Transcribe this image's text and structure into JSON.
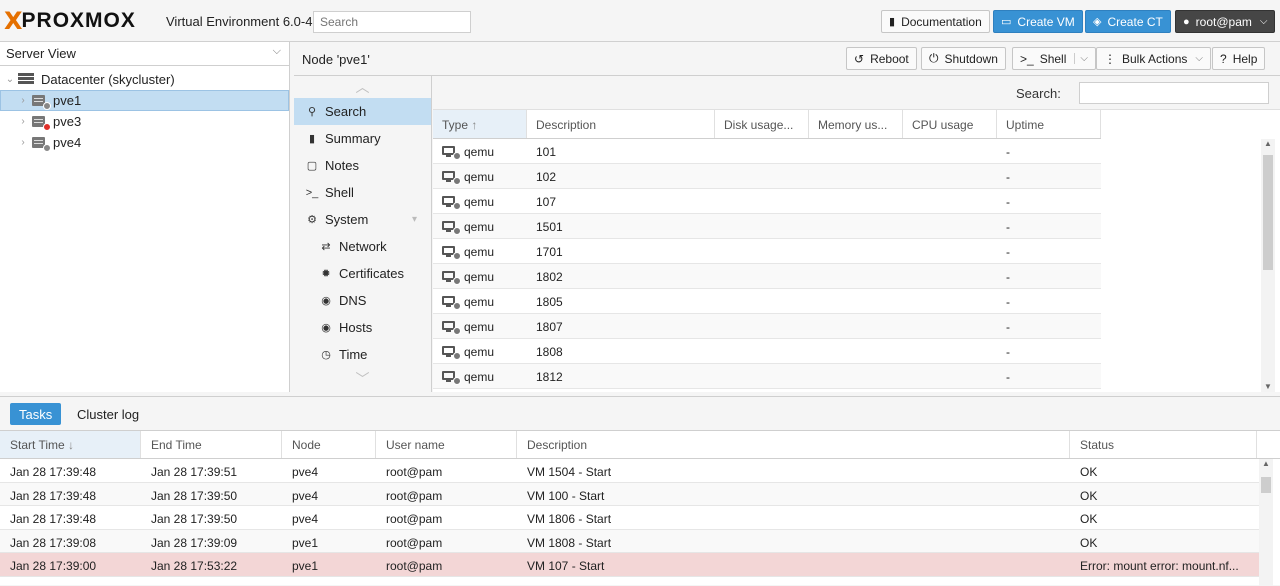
{
  "topbar": {
    "logo_x": "X",
    "logo_text": "PROXMOX",
    "version": "Virtual Environment 6.0-4",
    "search_placeholder": "Search",
    "documentation": "Documentation",
    "create_vm": "Create VM",
    "create_ct": "Create CT",
    "user": "root@pam"
  },
  "tree": {
    "view": "Server View",
    "datacenter": "Datacenter (skycluster)",
    "nodes": [
      {
        "label": "pve1",
        "status": "online"
      },
      {
        "label": "pve3",
        "status": "offline"
      },
      {
        "label": "pve4",
        "status": "online"
      }
    ]
  },
  "node": {
    "title": "Node 'pve1'",
    "reboot": "Reboot",
    "shutdown": "Shutdown",
    "shell": "Shell",
    "bulk_actions": "Bulk Actions",
    "help": "Help"
  },
  "menu": {
    "search": "Search",
    "summary": "Summary",
    "notes": "Notes",
    "shell": "Shell",
    "system": "System",
    "network": "Network",
    "certificates": "Certificates",
    "dns": "DNS",
    "hosts": "Hosts",
    "time": "Time"
  },
  "grid": {
    "search_label": "Search:",
    "headers": [
      "Type",
      "Description",
      "Disk usage...",
      "Memory us...",
      "CPU usage",
      "Uptime"
    ],
    "rows": [
      {
        "type": "qemu",
        "desc": "101",
        "uptime": "-"
      },
      {
        "type": "qemu",
        "desc": "102",
        "uptime": "-"
      },
      {
        "type": "qemu",
        "desc": "107",
        "uptime": "-"
      },
      {
        "type": "qemu",
        "desc": "1501",
        "uptime": "-"
      },
      {
        "type": "qemu",
        "desc": "1701",
        "uptime": "-"
      },
      {
        "type": "qemu",
        "desc": "1802",
        "uptime": "-"
      },
      {
        "type": "qemu",
        "desc": "1805",
        "uptime": "-"
      },
      {
        "type": "qemu",
        "desc": "1807",
        "uptime": "-"
      },
      {
        "type": "qemu",
        "desc": "1808",
        "uptime": "-"
      },
      {
        "type": "qemu",
        "desc": "1812",
        "uptime": "-"
      }
    ]
  },
  "tasks": {
    "tab_tasks": "Tasks",
    "tab_cluster_log": "Cluster log",
    "headers": [
      "Start Time",
      "End Time",
      "Node",
      "User name",
      "Description",
      "Status"
    ],
    "rows": [
      {
        "start": "Jan 28 17:39:48",
        "end": "Jan 28 17:39:51",
        "node": "pve4",
        "user": "root@pam",
        "desc": "VM 1504 - Start",
        "status": "OK",
        "error": false
      },
      {
        "start": "Jan 28 17:39:48",
        "end": "Jan 28 17:39:50",
        "node": "pve4",
        "user": "root@pam",
        "desc": "VM 100 - Start",
        "status": "OK",
        "error": false
      },
      {
        "start": "Jan 28 17:39:48",
        "end": "Jan 28 17:39:50",
        "node": "pve4",
        "user": "root@pam",
        "desc": "VM 1806 - Start",
        "status": "OK",
        "error": false
      },
      {
        "start": "Jan 28 17:39:08",
        "end": "Jan 28 17:39:09",
        "node": "pve1",
        "user": "root@pam",
        "desc": "VM 1808 - Start",
        "status": "OK",
        "error": false
      },
      {
        "start": "Jan 28 17:39:00",
        "end": "Jan 28 17:53:22",
        "node": "pve1",
        "user": "root@pam",
        "desc": "VM 107 - Start",
        "status": "Error: mount error: mount.nf...",
        "error": true
      }
    ]
  },
  "colors": {
    "accent": "#3892d4",
    "logo_orange": "#e57000",
    "selected": "#c2ddf2",
    "error_row": "#f3d6d6"
  }
}
